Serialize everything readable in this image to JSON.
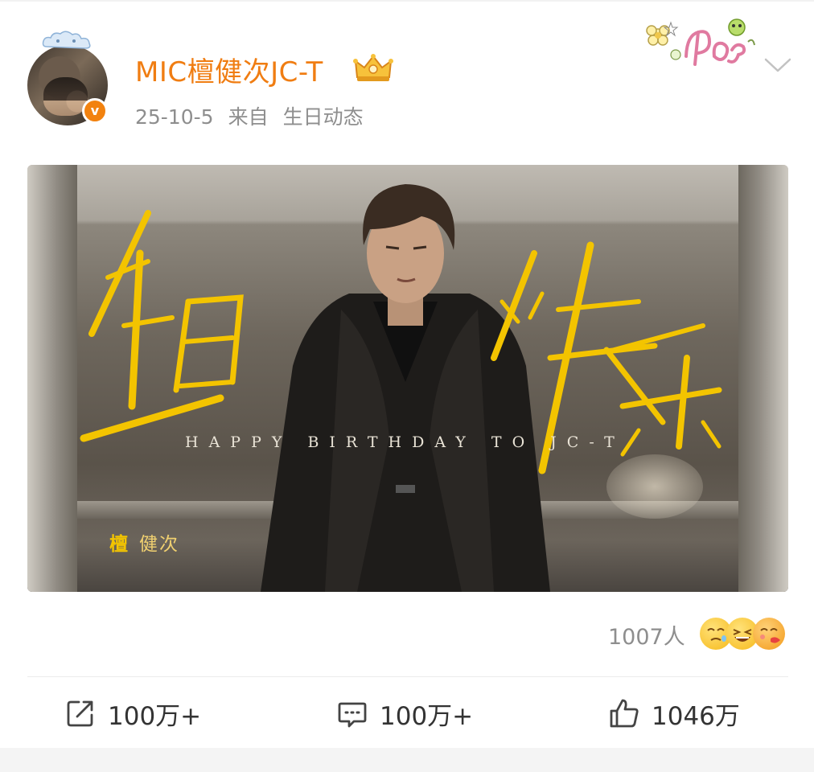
{
  "post": {
    "username": "MIC檀健次JC-T",
    "date": "25-10-5",
    "source_prefix": "来自",
    "source": "生日动态"
  },
  "poster": {
    "calligraphy": "生日快乐",
    "tagline": "HAPPY BIRTHDAY TO JC-T",
    "name_first": "檀",
    "name_rest": "健次"
  },
  "reactions": {
    "count": "1007人",
    "icons": [
      "sleepy-face-icon",
      "laughing-face-icon",
      "kissing-face-icon"
    ]
  },
  "actions": {
    "share": "100万+",
    "comment": "100万+",
    "like": "1046万"
  },
  "colors": {
    "username": "#f07d12",
    "verified": "#f2820f",
    "calligraphy": "#f3c400",
    "meta_text": "#8e8e8e"
  }
}
